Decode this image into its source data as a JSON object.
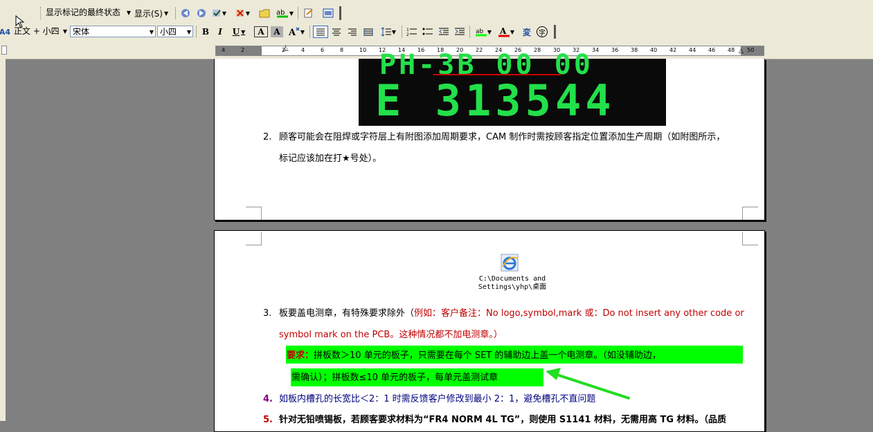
{
  "toolbar_reviewing": {
    "markup_state": "显示标记的最终状态",
    "show_label": "显示(S)"
  },
  "toolbar_format": {
    "style": "正文 + 小四",
    "font": "宋体",
    "size": "小四",
    "bold": "B",
    "italic": "I",
    "underline": "U",
    "char_border": "A",
    "char_shading": "A",
    "phonetic": "変",
    "enclose": "字"
  },
  "ruler": {
    "ticks": [
      "4",
      "2",
      "2",
      "4",
      "6",
      "8",
      "10",
      "12",
      "14",
      "16",
      "18",
      "20",
      "22",
      "24",
      "26",
      "28",
      "30",
      "32",
      "34",
      "36",
      "38",
      "40",
      "42",
      "44",
      "46",
      "48",
      "50"
    ]
  },
  "page1": {
    "plate_line1": "PH-3B 00 00",
    "plate_line2": "E 313544",
    "item2_num": "2.",
    "item2_line1": "顾客可能会在阻焊或字符层上有附图添加周期要求，CAM 制作时需按顾客指定位置添加生产周期（如附图所示，",
    "item2_line2": "标记应该加在打★号处）。"
  },
  "page2": {
    "caption_line1": "C:\\Documents and",
    "caption_line2": "Settings\\yhp\\桌面",
    "item3_num": "3.",
    "item3_line1_black": "板要盖电测章，有特殊要求除外（",
    "item3_line1_red": "例如：客户备注：No logo,symbol,mark 或：Do not insert any other code or",
    "item3_line2_red": "symbol mark on the PCB。这种情况都不加电测章。）",
    "req_label": "要求：",
    "req_line1": "拼板数＞10 单元的板子，只需要在每个 SET 的辅助边上盖一个电测章。（如没辅助边，",
    "req_line2": "需确认）；拼板数≤10 单元的板子，每单元盖测试章",
    "item4_num": "4.",
    "item4_text": "如板内槽孔的长宽比＜2：1 时需反馈客户修改到最小 2：1，避免槽孔不直问题",
    "item5_num": "5.",
    "item5_text": "针对无铅喷锡板，若顾客要求材料为“FR4 NORM 4L TG”，则使用 S1141 材料，无需用高 TG 材料。（品质"
  },
  "colors": {
    "highlight": "#00ff00",
    "red_text": "#c00000",
    "plate_green": "#22e04a",
    "arrow_green": "#22dd22"
  }
}
